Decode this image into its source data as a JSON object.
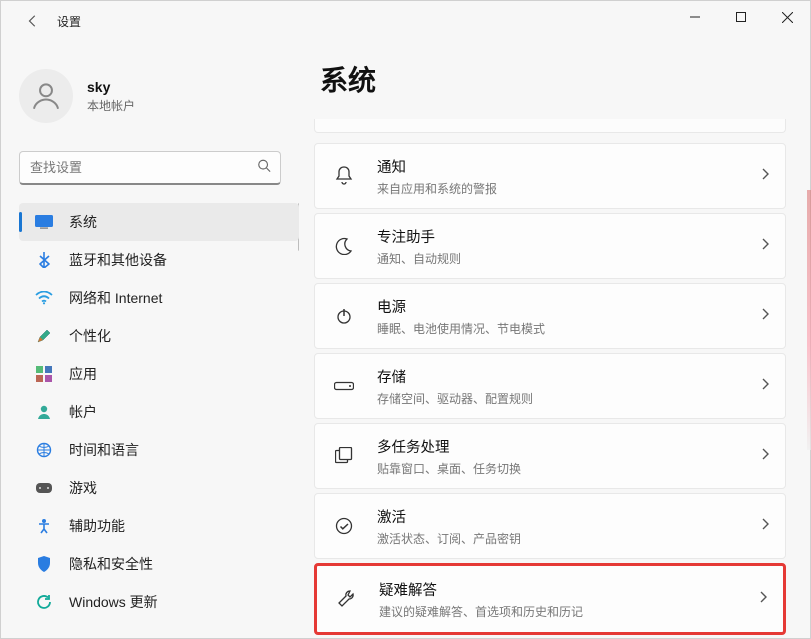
{
  "titlebar": {
    "title": "设置"
  },
  "user": {
    "name": "sky",
    "sub": "本地帐户"
  },
  "search": {
    "placeholder": "查找设置"
  },
  "sidebar": {
    "items": [
      {
        "label": "系统"
      },
      {
        "label": "蓝牙和其他设备"
      },
      {
        "label": "网络和 Internet"
      },
      {
        "label": "个性化"
      },
      {
        "label": "应用"
      },
      {
        "label": "帐户"
      },
      {
        "label": "时间和语言"
      },
      {
        "label": "游戏"
      },
      {
        "label": "辅助功能"
      },
      {
        "label": "隐私和安全性"
      },
      {
        "label": "Windows 更新"
      }
    ]
  },
  "main": {
    "title": "系统",
    "cards": [
      {
        "title": "通知",
        "sub": "来自应用和系统的警报"
      },
      {
        "title": "专注助手",
        "sub": "通知、自动规则"
      },
      {
        "title": "电源",
        "sub": "睡眠、电池使用情况、节电模式"
      },
      {
        "title": "存储",
        "sub": "存储空间、驱动器、配置规则"
      },
      {
        "title": "多任务处理",
        "sub": "贴靠窗口、桌面、任务切换"
      },
      {
        "title": "激活",
        "sub": "激活状态、订阅、产品密钥"
      },
      {
        "title": "疑难解答",
        "sub": "建议的疑难解答、首选项和历史和历记"
      }
    ]
  }
}
